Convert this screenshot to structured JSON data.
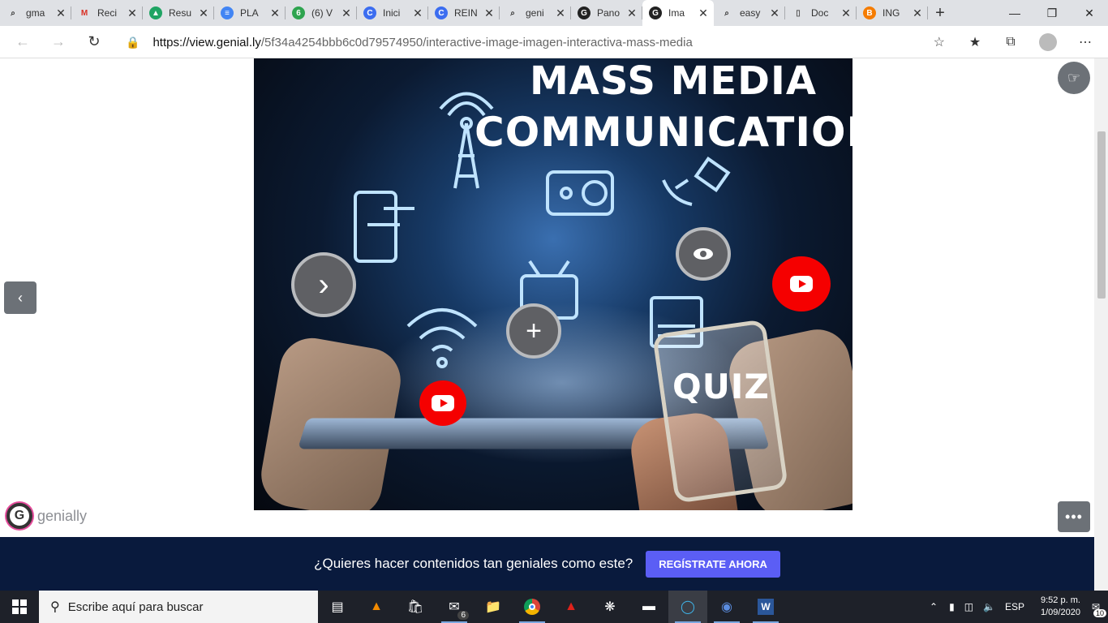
{
  "tabs": [
    {
      "title": "gma",
      "icon": "search-icon",
      "color": "#333333",
      "active": false
    },
    {
      "title": "Reci",
      "icon": "gmail-icon",
      "color": "#d93025",
      "active": false
    },
    {
      "title": "Resu",
      "icon": "google-drive-icon",
      "color": "#1fa463",
      "active": false
    },
    {
      "title": "PLA",
      "icon": "google-docs-icon",
      "color": "#4285f4",
      "active": false
    },
    {
      "title": "(6) V",
      "icon": "green-circle-icon",
      "color": "#2ea44f",
      "active": false
    },
    {
      "title": "Inici",
      "icon": "c-circle-icon",
      "color": "#3c6df0",
      "active": false
    },
    {
      "title": "REIN",
      "icon": "c-circle-icon",
      "color": "#3c6df0",
      "active": false
    },
    {
      "title": "geni",
      "icon": "search-icon",
      "color": "#333333",
      "active": false
    },
    {
      "title": "Pano",
      "icon": "genially-icon",
      "color": "#222222",
      "active": false
    },
    {
      "title": "Ima",
      "icon": "genially-icon",
      "color": "#222222",
      "active": true
    },
    {
      "title": "easy",
      "icon": "search-icon",
      "color": "#333333",
      "active": false
    },
    {
      "title": "Doc",
      "icon": "document-icon",
      "color": "#555555",
      "active": false
    },
    {
      "title": "ING",
      "icon": "blogger-icon",
      "color": "#f57c00",
      "active": false
    }
  ],
  "browser": {
    "url_host": "https://view.genial.ly",
    "url_path": "/5f34a4254bbb6c0d79574950/interactive-image-imagen-interactiva-mass-media"
  },
  "stage": {
    "title_line1": "MASS MEDIA",
    "title_line2": "COMMUNICATION",
    "quiz_label": "QUIZ"
  },
  "brand": {
    "logo_text": "genially"
  },
  "promo": {
    "text": "¿Quieres hacer contenidos tan geniales como este?",
    "button": "REGÍSTRATE AHORA"
  },
  "taskbar": {
    "search_placeholder": "Escribe aquí para buscar",
    "mail_badge": "6",
    "language": "ESP",
    "time": "9:52 p. m.",
    "date": "1/09/2020",
    "notifications": "10"
  },
  "colors": {
    "accent_button": "#5b5ef5",
    "promo_bg": "#091a3d",
    "youtube_red": "#f50000"
  }
}
